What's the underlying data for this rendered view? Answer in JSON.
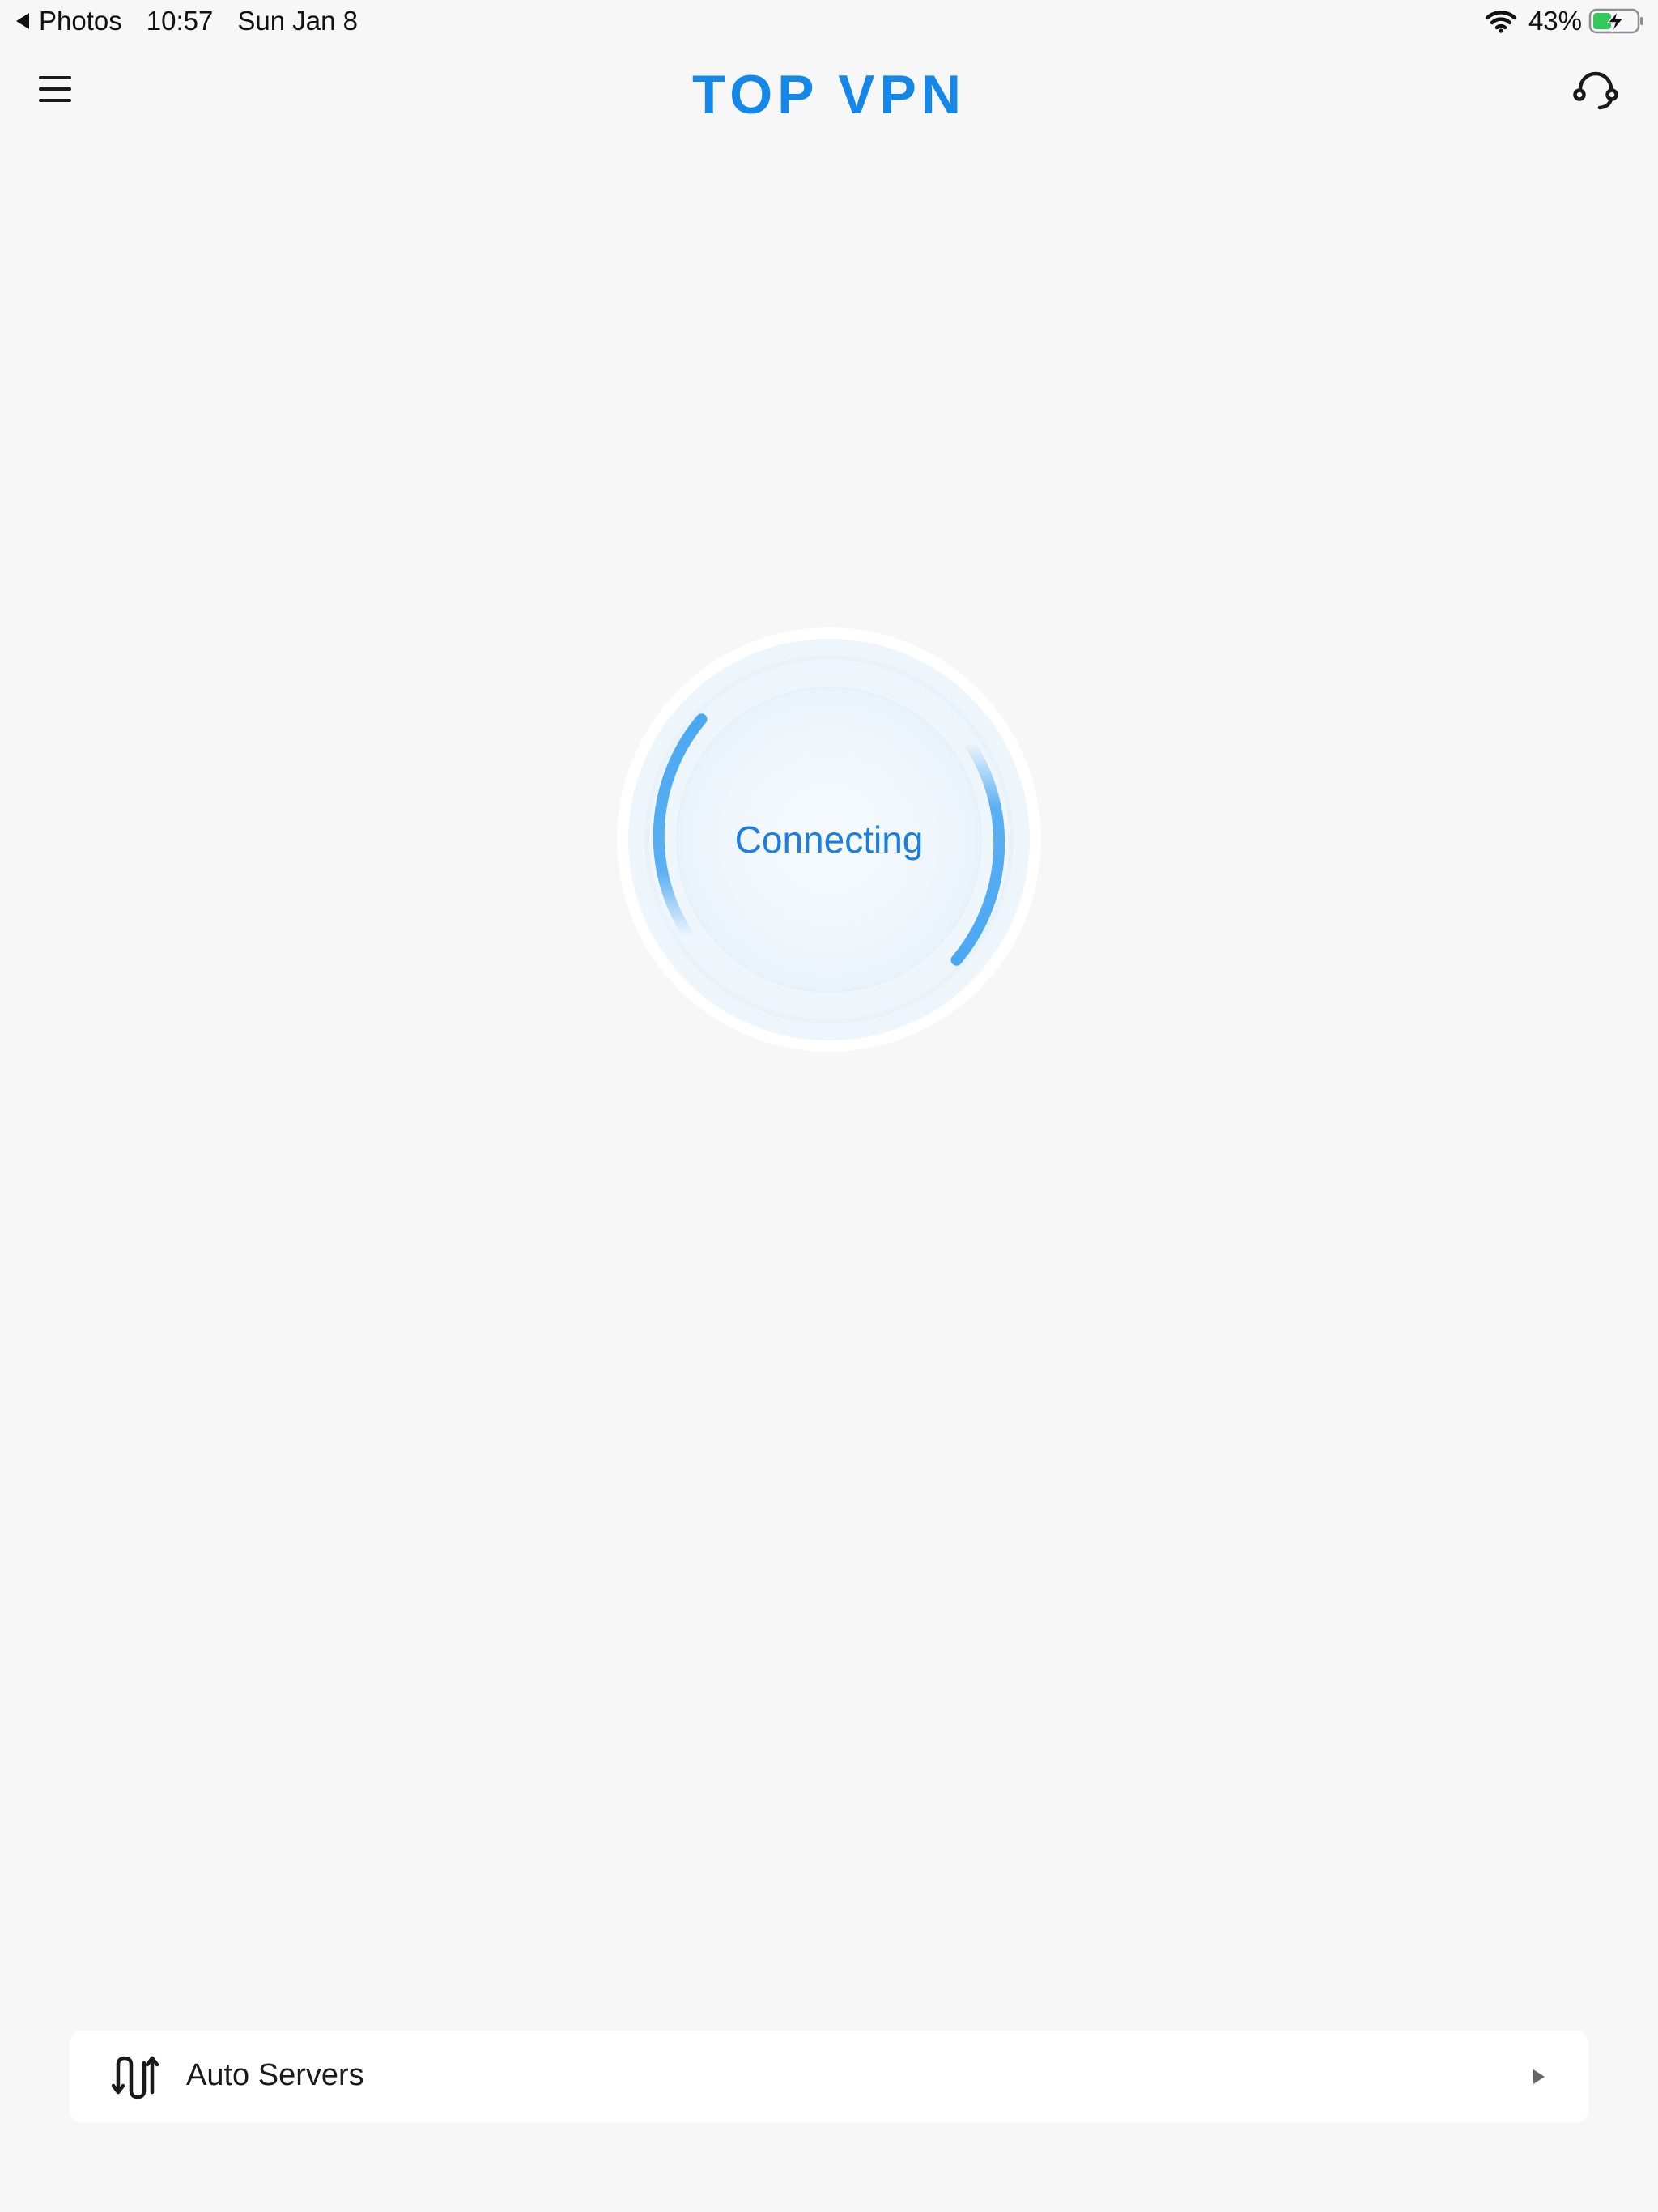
{
  "status_bar": {
    "back_label": "Photos",
    "time": "10:57",
    "date": "Sun Jan 8",
    "battery_percent": "43%",
    "battery_level": 0.43,
    "icons": [
      "back-triangle-icon",
      "wifi-icon",
      "battery-charging-icon"
    ]
  },
  "header": {
    "title": "TOP VPN",
    "menu_icon": "hamburger-menu-icon",
    "support_icon": "headset-support-icon"
  },
  "connection": {
    "status": "Connecting"
  },
  "server": {
    "label": "Auto Servers",
    "icon": "route-arrows-icon",
    "chevron_icon": "play-triangle-icon"
  },
  "colors": {
    "accent": "#1488ea",
    "ring_arc": "#4aa8f2",
    "background": "#f7f7f7",
    "battery_green": "#34c759"
  }
}
